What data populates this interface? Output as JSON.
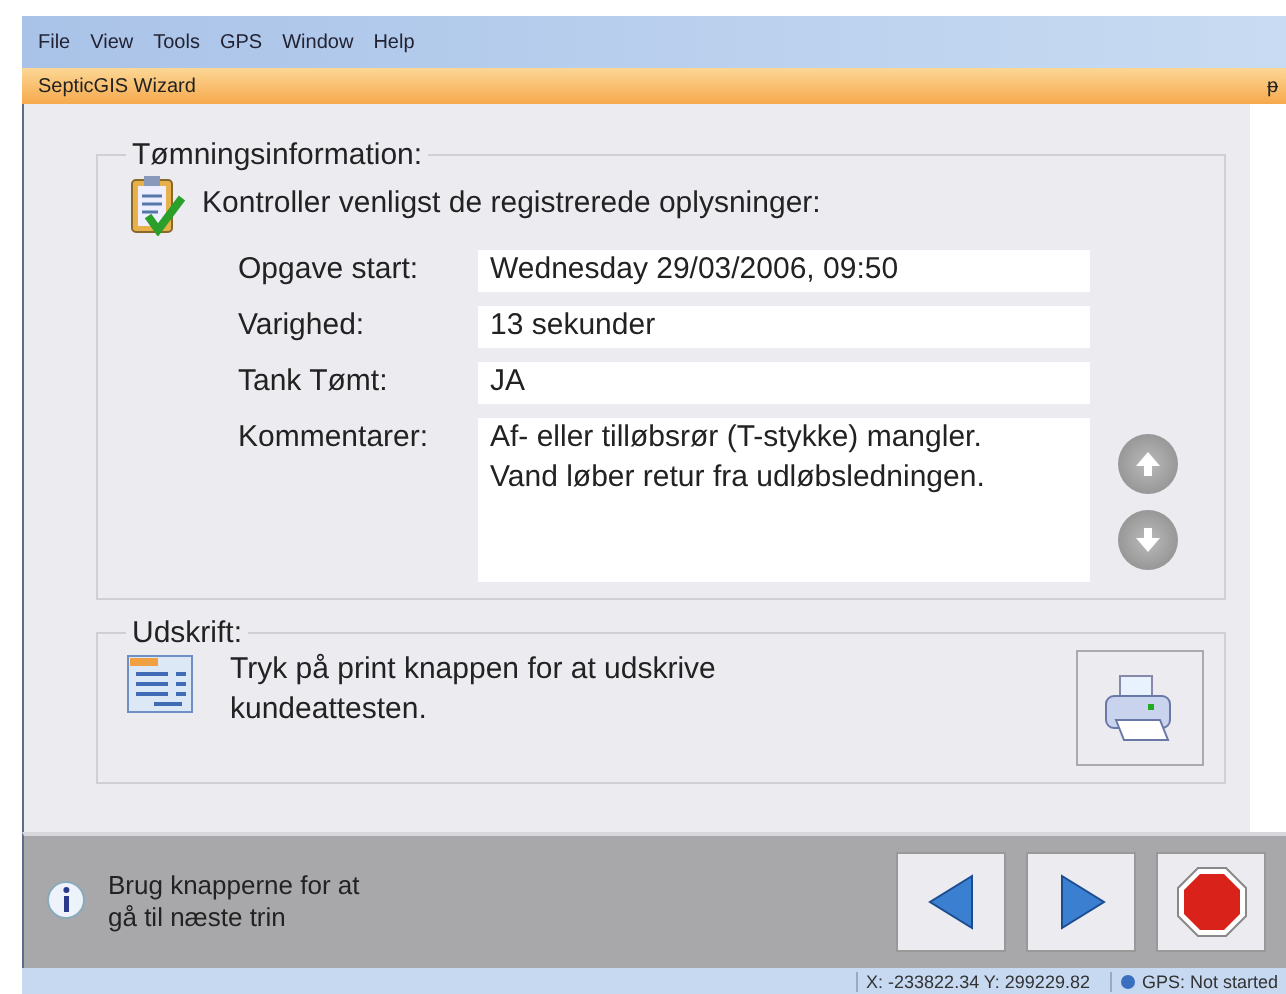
{
  "menu": [
    "File",
    "View",
    "Tools",
    "GPS",
    "Window",
    "Help"
  ],
  "panel": {
    "title": "SepticGIS Wizard",
    "pin": "ᵽ"
  },
  "info_group": {
    "title": "Tømningsinformation:",
    "instruction": "Kontroller venligst de registrerede oplysninger:",
    "fields": [
      {
        "label": "Opgave start:",
        "value": "Wednesday 29/03/2006, 09:50",
        "kind": "line"
      },
      {
        "label": "Varighed:",
        "value": "13 sekunder",
        "kind": "line"
      },
      {
        "label": "Tank Tømt:",
        "value": "JA",
        "kind": "line"
      },
      {
        "label": "Kommentarer:",
        "value": "Af- eller tilløbsrør (T-stykke) mangler.\nVand løber retur fra udløbsledningen.",
        "kind": "multi"
      }
    ]
  },
  "print_group": {
    "title": "Udskrift:",
    "text": "Tryk på print knappen for at udskrive kundeattesten."
  },
  "hint": "Brug knapperne for at\ngå til næste trin",
  "status_bar": {
    "coords": "X: -233822.34 Y: 299229.82",
    "gps": "GPS: Not started"
  }
}
